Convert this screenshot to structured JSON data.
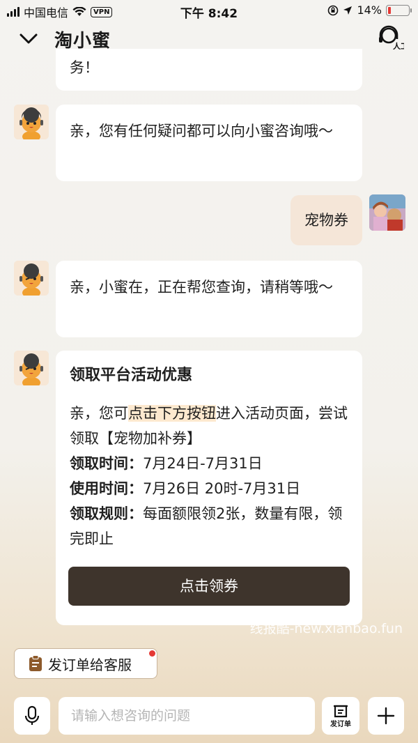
{
  "status_bar": {
    "carrier": "中国电信",
    "vpn": "VPN",
    "time": "下午 8:42",
    "battery": "14%"
  },
  "nav": {
    "title": "淘小蜜",
    "agent_label": "人工"
  },
  "messages": {
    "partial_text": "务！",
    "bot1": "亲，您有任何疑问都可以向小蜜咨询哦～",
    "user1": "宠物券",
    "bot2": "亲，小蜜在，正在帮您查询，请稍等哦～"
  },
  "card": {
    "title": "领取平台活动优惠",
    "intro_before": "亲，您可",
    "intro_highlight": "点击下方按钮",
    "intro_after": "进入活动页面，尝试领取【宠物加补券】",
    "time_label": "领取时间：",
    "time_value": "7月24日-7月31日",
    "use_label": "使用时间：",
    "use_value": "7月26日 20时-7月31日",
    "rule_label": "领取规则：",
    "rule_value": "每面额限领2张，数量有限，领完即止",
    "button": "点击领券"
  },
  "watermark": "线报酷-new.xianbao.fun",
  "order_chip": "发订单给客服",
  "input": {
    "placeholder": "请输入想咨询的问题",
    "order_label": "发订单"
  },
  "colors": {
    "button_bg": "#3e342c",
    "highlight": "#fde9cf",
    "user_bubble": "#f5e6d8",
    "badge": "#e53935"
  }
}
